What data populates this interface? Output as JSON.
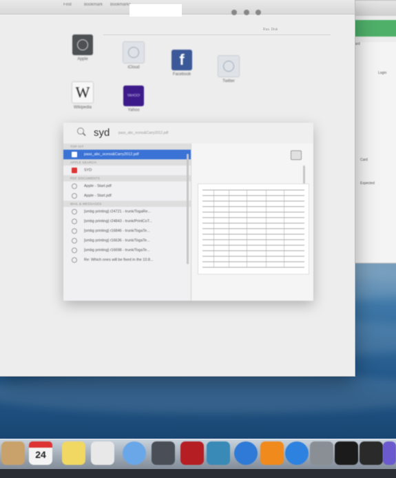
{
  "browser": {
    "tabs": [
      "Find",
      "Bookmark",
      "Bookmarks"
    ],
    "url_hint": "Rus. Disk"
  },
  "favorites": [
    {
      "label": "Apple",
      "icon": "safari-icon"
    },
    {
      "label": "iCloud",
      "icon": "compass-icon"
    },
    {
      "label": "Facebook",
      "icon": "facebook-icon",
      "glyph": "f"
    },
    {
      "label": "Twitter",
      "icon": "compass-icon"
    },
    {
      "label": "Wikipedia",
      "icon": "wikipedia-icon",
      "glyph": "W"
    },
    {
      "label": "Yahoo",
      "icon": "yahoo-icon",
      "glyph": "YAHOO!"
    }
  ],
  "spotlight": {
    "query": "syd",
    "hint": "pass_abc_ocess&Carry2012.pdf",
    "sections": [
      {
        "header": "TOP HIT",
        "items": [
          {
            "text": "pass_abc_ocess&Carry2012.pdf",
            "selected": true
          }
        ]
      },
      {
        "header": "APPLE SEARCH",
        "items": [
          {
            "text": "SYD",
            "red": true
          }
        ]
      },
      {
        "header": "PDF DOCUMENTS",
        "items": [
          {
            "text": "Apple - Start.pdf"
          },
          {
            "text": "Apple - Start.pdf"
          }
        ]
      },
      {
        "header": "MAIL & MESSAGES",
        "items": [
          {
            "text": "[smbg printing] r24721 - trunk/TogaRe..."
          },
          {
            "text": "[smbg printing] r24843 - trunk/PrintCoT..."
          },
          {
            "text": "[smbg printing] r16846 - trunk/TogaTe..."
          },
          {
            "text": "[smbg printing] r16636 - trunk/TogaTe..."
          },
          {
            "text": "[smbg printing] r16698 - trunk/TogaTe..."
          },
          {
            "text": "Re: Which ones will be fixed in the 10.8..."
          }
        ]
      }
    ]
  },
  "dock": {
    "calendar_day": "24",
    "items": [
      "finder-icon",
      "calendar-icon",
      "notes-icon",
      "reminders-icon",
      "messages-icon",
      "facetime-icon",
      "photo-booth-icon",
      "photos-icon",
      "itunes-icon",
      "ibooks-icon",
      "app-store-icon",
      "system-preferences-icon",
      "terminal-icon",
      "activity-monitor-icon"
    ]
  },
  "back_window": {
    "labels": [
      "Port & Forward",
      "Login",
      "Card",
      "Expected"
    ]
  }
}
